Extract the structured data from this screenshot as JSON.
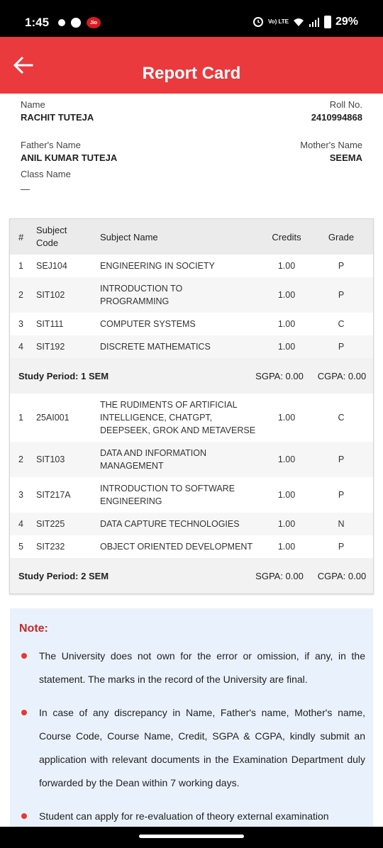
{
  "status_bar": {
    "time": "1:45",
    "network_label": "Vo) LTE",
    "battery": "29%"
  },
  "header": {
    "title": "Report Card"
  },
  "student": {
    "name_label": "Name",
    "name": "RACHIT TUTEJA",
    "roll_label": "Roll No.",
    "roll": "2410994868",
    "father_label": "Father's Name",
    "father": "ANIL KUMAR TUTEJA",
    "mother_label": "Mother's Name",
    "mother": "SEEMA",
    "class_label": "Class Name",
    "class_value": "—"
  },
  "table": {
    "headers": {
      "num": "#",
      "code": "Subject Code",
      "name": "Subject Name",
      "credits": "Credits",
      "grade": "Grade"
    },
    "sem1": [
      {
        "num": "1",
        "code": "SEJ104",
        "name": "ENGINEERING IN SOCIETY",
        "credits": "1.00",
        "grade": "P"
      },
      {
        "num": "2",
        "code": "SIT102",
        "name": "INTRODUCTION TO PROGRAMMING",
        "credits": "1.00",
        "grade": "P"
      },
      {
        "num": "3",
        "code": "SIT111",
        "name": "COMPUTER SYSTEMS",
        "credits": "1.00",
        "grade": "C"
      },
      {
        "num": "4",
        "code": "SIT192",
        "name": "DISCRETE MATHEMATICS",
        "credits": "1.00",
        "grade": "P"
      }
    ],
    "sem1_summary": {
      "period": "Study Period: 1 SEM",
      "sgpa": "SGPA: 0.00",
      "cgpa": "CGPA: 0.00"
    },
    "sem2": [
      {
        "num": "1",
        "code": "25AI001",
        "name": "THE RUDIMENTS OF ARTIFICIAL INTELLIGENCE, CHATGPT, DEEPSEEK, GROK AND METAVERSE",
        "credits": "1.00",
        "grade": "C"
      },
      {
        "num": "2",
        "code": "SIT103",
        "name": "DATA AND INFORMATION MANAGEMENT",
        "credits": "1.00",
        "grade": "P"
      },
      {
        "num": "3",
        "code": "SIT217A",
        "name": "INTRODUCTION TO SOFTWARE ENGINEERING",
        "credits": "1.00",
        "grade": "P"
      },
      {
        "num": "4",
        "code": "SIT225",
        "name": "DATA CAPTURE TECHNOLOGIES",
        "credits": "1.00",
        "grade": "N"
      },
      {
        "num": "5",
        "code": "SIT232",
        "name": "OBJECT ORIENTED DEVELOPMENT",
        "credits": "1.00",
        "grade": "P"
      }
    ],
    "sem2_summary": {
      "period": "Study Period: 2 SEM",
      "sgpa": "SGPA: 0.00",
      "cgpa": "CGPA: 0.00"
    }
  },
  "note": {
    "title": "Note:",
    "items": [
      "The University does not own for the error or omission, if any, in the statement. The marks in the record of the University are final.",
      "In case of any discrepancy in Name, Father's name, Mother's name, Course Code, Course Name, Credit, SGPA & CGPA, kindly submit an application with relevant documents in the Examination Department duly forwarded by the Dean within 7 working days.",
      "Student can apply for re-evaluation of theory external examination"
    ]
  },
  "colors": {
    "header_bg": "#ea3a3d",
    "note_bg": "#e9f2fc",
    "note_title": "#c62828",
    "bullet": "#e53935"
  }
}
